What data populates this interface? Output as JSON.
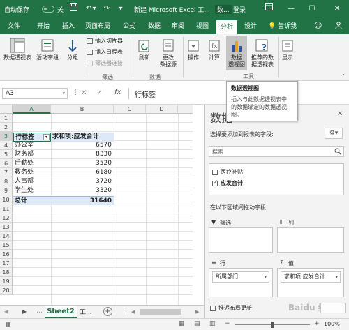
{
  "titlebar": {
    "autosave": "自动保存",
    "autosave_state": "关",
    "title": "新建 Microsoft Excel 工...",
    "context_tab": "数...",
    "login": "登录"
  },
  "tabs": [
    "文件",
    "开始",
    "插入",
    "页面布局",
    "公式",
    "数据",
    "审阅",
    "视图",
    "分析",
    "设计"
  ],
  "tell_me": "告诉我",
  "ribbon": {
    "pivot_table": "数据透视表",
    "active_field": "活动字段",
    "group": "分组",
    "insert_slicer": "插入切片器",
    "insert_timeline": "插入日程表",
    "filter_connections": "筛选器连接",
    "filter_group": "筛选",
    "refresh": "刷新",
    "change_source": "更改",
    "change_source2": "数据源",
    "data_group": "数据",
    "actions": "操作",
    "calculations": "计算",
    "pivot_chart": "数据",
    "pivot_chart2": "透视图",
    "recommended": "推荐的数",
    "recommended2": "据透视表",
    "tools_group": "工具",
    "show": "显示"
  },
  "tooltip": {
    "title": "数据透视图",
    "desc1": "插入与此数据透视表中",
    "desc2": "的数据绑定的数据透视",
    "desc3": "图。"
  },
  "formula_bar": {
    "namebox": "A3",
    "fx": "fx",
    "value": "行标签"
  },
  "grid": {
    "columns": [
      "A",
      "B",
      "C",
      "D"
    ],
    "rows": [
      "1",
      "2",
      "3",
      "4",
      "5",
      "6",
      "7",
      "8",
      "9",
      "10",
      "11",
      "12",
      "13",
      "14",
      "15",
      "16",
      "17",
      "18",
      "19",
      "20"
    ],
    "header_label": "行标签",
    "header_value": "求和项:应发合计",
    "items": [
      {
        "label": "办公室",
        "value": "6570"
      },
      {
        "label": "财务部",
        "value": "8330"
      },
      {
        "label": "后勤处",
        "value": "3520"
      },
      {
        "label": "教务处",
        "value": "6180"
      },
      {
        "label": "人事部",
        "value": "3720"
      },
      {
        "label": "学生处",
        "value": "3320"
      }
    ],
    "total_label": "总计",
    "total_value": "31640"
  },
  "sheets": {
    "active": "Sheet2",
    "other": "工..."
  },
  "status": {
    "zoom": "100%"
  },
  "pane": {
    "title": "数据",
    "subtitle": "选择要添加到报表的字段:",
    "search_placeholder": "搜索",
    "fields": [
      {
        "name": "医疗补贴",
        "checked": false
      },
      {
        "name": "应发合计",
        "checked": true
      }
    ],
    "drag_label": "在以下区域间拖动字段:",
    "area_filter": "筛选",
    "area_columns": "列",
    "area_rows": "行",
    "area_values": "值",
    "row_field": "所属部门",
    "value_field": "求和项:应发合计",
    "defer_update": "推迟布局更新",
    "watermark": "Baidu 经验"
  },
  "colors": {
    "excel_green": "#217346",
    "ribbon_bg": "#f3f3f3",
    "pivot_header_bg": "#dde9f7"
  }
}
